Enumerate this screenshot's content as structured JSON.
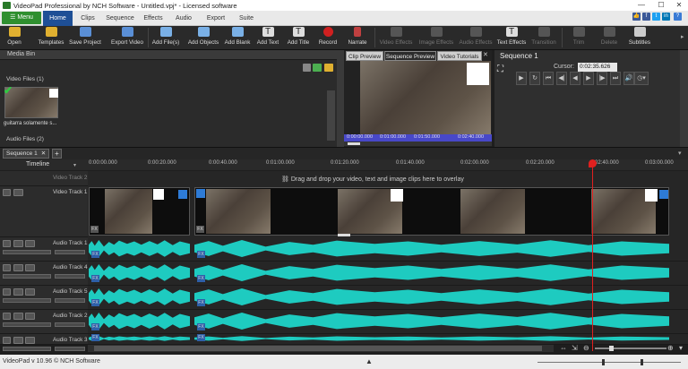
{
  "window": {
    "title": "VideoPad Professional by NCH Software - Untitled.vpj* - Licensed software"
  },
  "menu": {
    "menu_label": "Menu",
    "tabs": [
      "Home",
      "Clips",
      "Sequence",
      "Effects",
      "Audio",
      "Export",
      "Suite"
    ],
    "active_tab": "Home"
  },
  "ribbon": {
    "buttons": [
      "Open",
      "Templates",
      "Save Project",
      "Export Video",
      "Add File(s)",
      "Add Objects",
      "Add Blank",
      "Add Text",
      "Add Title",
      "Record",
      "Narrate",
      "Video Effects",
      "Image Effects",
      "Audio Effects",
      "Text Effects",
      "Transition",
      "Trim",
      "Delete",
      "Subtitles"
    ]
  },
  "media_bin": {
    "title": "Media Bin",
    "video_section": "Video Files (1)",
    "audio_section": "Audio Files (2)",
    "clip_name": "guitarra solamente s..."
  },
  "preview": {
    "tabs": [
      "Clip Preview",
      "Sequence Preview",
      "Video Tutorials"
    ],
    "active_tab": "Sequence Preview",
    "timecodes": [
      "0:00:00.000",
      "0:01:00.000",
      "0:01:50.000",
      "0:02:40.000"
    ]
  },
  "sequence_panel": {
    "title": "Sequence 1",
    "cursor_label": "Cursor:",
    "cursor_value": "0:02:35.626"
  },
  "sequence_tab": {
    "label": "Sequence 1",
    "add_label": "+"
  },
  "timeline": {
    "label": "Timeline",
    "ticks": [
      "0:00:00.000",
      "0:00:20.000",
      "0:00:40.000",
      "0:01:00.000",
      "0:01:20.000",
      "0:01:40.000",
      "0:02:00.000",
      "0:02:20.000",
      "0:02:40.000",
      "0:03:00.000"
    ],
    "overlay_hint": "Drag and drop your video, text and image clips here to overlay"
  },
  "tracks": {
    "video2": "Video Track 2",
    "video1": "Video Track 1",
    "audio": [
      "Audio Track 1",
      "Audio Track 4",
      "Audio Track 5",
      "Audio Track 2",
      "Audio Track 3"
    ]
  },
  "status": {
    "text": "VideoPad v 10.96 © NCH Software"
  },
  "colors": {
    "menu_green": "#2f8f2f",
    "active_tab_blue": "#1e4f96",
    "waveform": "#1ecbc0",
    "playhead": "#e0201f"
  }
}
